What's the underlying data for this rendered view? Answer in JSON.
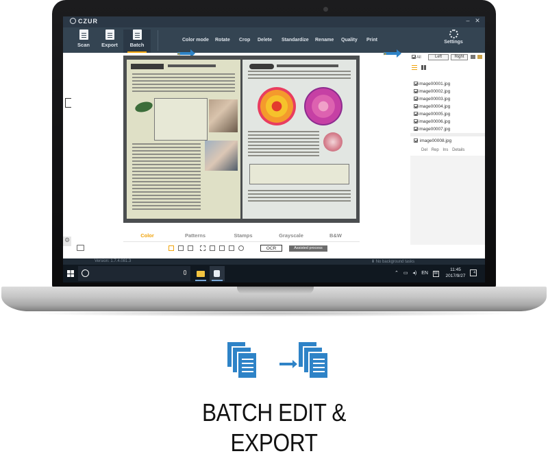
{
  "app": {
    "brand": "CZUR"
  },
  "toolbar": {
    "tools": [
      {
        "label": "Scan"
      },
      {
        "label": "Export"
      },
      {
        "label": "Batch",
        "active": true
      }
    ],
    "prev_arrow": "<",
    "next_arrow": ">",
    "options": [
      "Color mode",
      "Rotate",
      "Crop",
      "Delete",
      "Standardize",
      "Rename",
      "Quality",
      "Print"
    ],
    "settings_label": "Settings"
  },
  "filters": {
    "tabs": [
      "Color",
      "Patterns",
      "Stamps",
      "Grayscale",
      "B&W"
    ],
    "active": "Color"
  },
  "subtools": {
    "ocr_label": "OCR",
    "assist_label": "Assisted process"
  },
  "right_panel": {
    "all_label": "All",
    "left_label": "Left",
    "right_label": "Right",
    "images": [
      "image00001.jpg",
      "image00002.jpg",
      "image00003.jpg",
      "image00004.jpg",
      "image00005.jpg",
      "image00006.jpg",
      "image00007.jpg"
    ],
    "selected_image": "image00008.jpg",
    "actions": [
      "Del",
      "Rep",
      "Ins",
      "Details"
    ]
  },
  "statusbar": {
    "version": "Version: 1.7.4.081.3",
    "bg_tasks": "No background tasks"
  },
  "taskbar": {
    "language": "EN",
    "ime": "M",
    "time": "11:45",
    "date": "2017/9/27",
    "notifications": "4"
  },
  "headline": {
    "line1": "BATCH EDIT &",
    "line2": "EXPORT"
  },
  "colors": {
    "accent": "#f0a30a",
    "toolbar": "#344452",
    "titlebar": "#2b3846",
    "icon_blue": "#2e83c7"
  }
}
